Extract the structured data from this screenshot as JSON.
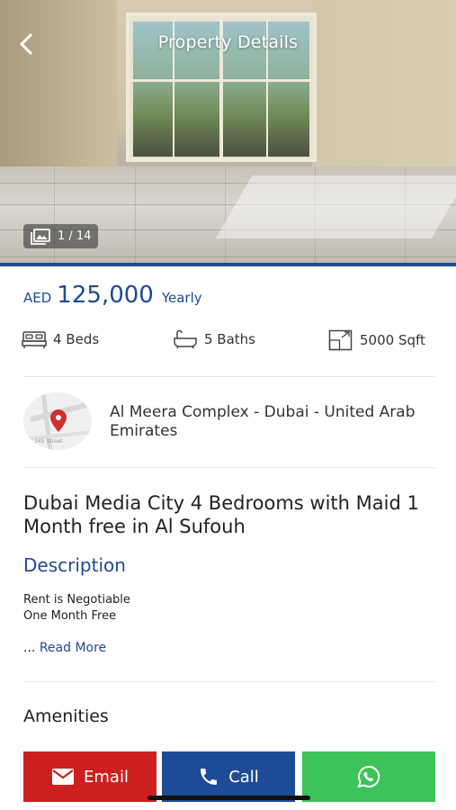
{
  "header": {
    "title": "Property Details",
    "back_icon": "chevron-left-icon"
  },
  "gallery": {
    "counter": "1 / 14",
    "icon": "photo-gallery-icon",
    "progress_index": 1,
    "progress_total": 14
  },
  "price": {
    "currency": "AED",
    "amount": "125,000",
    "period": "Yearly"
  },
  "specs": {
    "beds": "4 Beds",
    "baths": "5 Baths",
    "area": "5000 Sqft"
  },
  "location": {
    "address": "Al Meera Complex - Dubai - United Arab Emirates",
    "map_label": "345 Street"
  },
  "listing": {
    "title": "Dubai Media City  4 Bedrooms with Maid  1 Month free in Al Sufouh"
  },
  "description": {
    "heading": "Description",
    "lines": [
      "Rent is Negotiable",
      "One Month Free"
    ],
    "read_more_prefix": "...",
    "read_more": "Read More"
  },
  "amenities": {
    "heading": "Amenities"
  },
  "actions": {
    "email": "Email",
    "call": "Call",
    "whatsapp_icon": "whatsapp-icon"
  },
  "colors": {
    "brand_blue": "#1e4b95",
    "email_red": "#cc1f1f",
    "whatsapp_green": "#3cc35a"
  }
}
